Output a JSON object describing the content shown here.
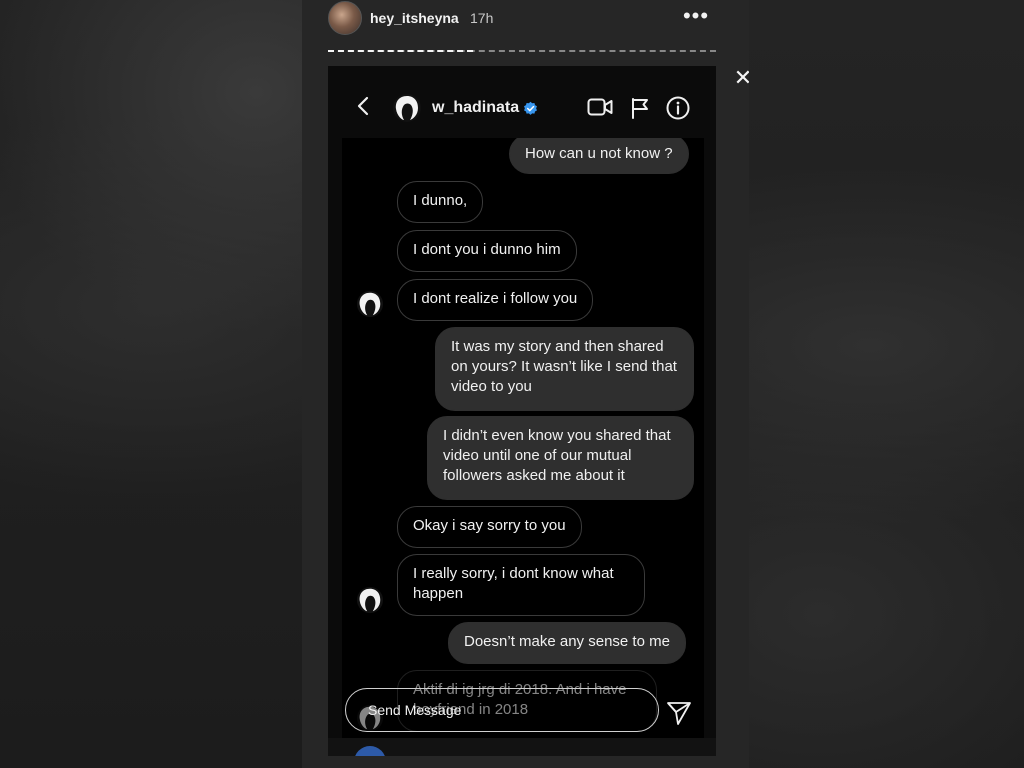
{
  "story": {
    "username": "hey_itsheyna",
    "time": "17h",
    "more_icon": "more-horizontal-icon",
    "close_icon": "close-icon"
  },
  "dm": {
    "contact_name": "w_hadinata",
    "verified": true,
    "icons": [
      "back-icon",
      "video-call-icon",
      "flag-icon",
      "info-icon"
    ],
    "messages": [
      {
        "side": "out",
        "text": "How can u not know ?"
      },
      {
        "side": "in",
        "text": "I dunno,"
      },
      {
        "side": "in",
        "text": "I dont you i dunno him"
      },
      {
        "side": "in",
        "text": "I dont realize i follow you",
        "avatar": true
      },
      {
        "side": "out",
        "text": "It was my story and then shared on yours? It wasn’t like I send that video to you"
      },
      {
        "side": "out",
        "text": "I didn’t even know you shared that video until one of our mutual followers asked me about it"
      },
      {
        "side": "in",
        "text": "Okay i say sorry to you"
      },
      {
        "side": "in",
        "text": "I really sorry, i dont know what happen",
        "avatar": true
      },
      {
        "side": "out",
        "text": "Doesn’t make any sense to me"
      },
      {
        "side": "in",
        "text": "Aktif di ig jrg di 2018. And i have boyfriend in 2018",
        "avatar": true
      }
    ],
    "composer": {
      "placeholder": "Send Message"
    }
  },
  "colors": {
    "outgoing_bubble": "#2f2f2f",
    "incoming_border": "#3a3a3a",
    "verified_blue": "#3897f0"
  }
}
